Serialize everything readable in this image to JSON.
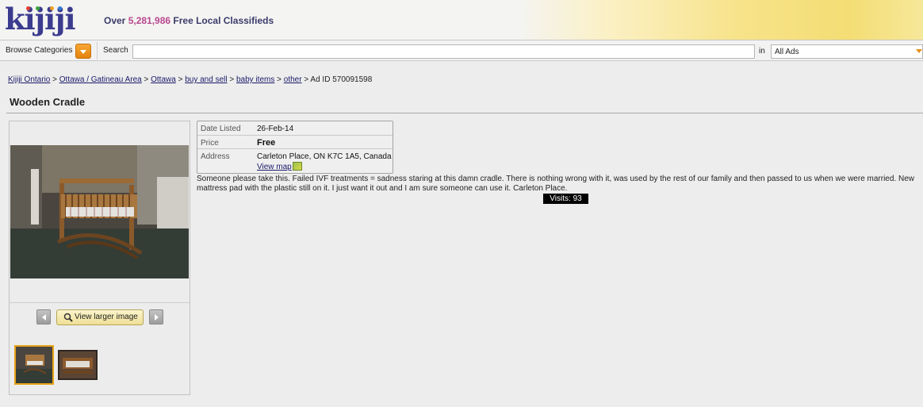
{
  "header": {
    "logo": "kijiji",
    "tagline_prefix": "Over ",
    "tagline_count": "5,281,986",
    "tagline_suffix": " Free Local Classifieds"
  },
  "searchbar": {
    "browse_label": "Browse Categories",
    "search_label": "Search",
    "search_value": "",
    "in_label": "in",
    "category_selected": "All Ads"
  },
  "breadcrumb": {
    "items": [
      "Kijiji Ontario",
      "Ottawa / Gatineau Area",
      "Ottawa",
      "buy and sell",
      "baby items",
      "other"
    ],
    "separator": ">",
    "ad_id": "Ad ID 570091598"
  },
  "page_title": "Wooden Cradle",
  "gallery": {
    "view_larger_label": "View larger image"
  },
  "details": {
    "date_label": "Date Listed",
    "date_value": "26-Feb-14",
    "price_label": "Price",
    "price_value": "Free",
    "address_label": "Address",
    "address_value": "Carleton Place, ON K7C 1A5, Canada",
    "map_link": "View map"
  },
  "description": "Someone please take this. Failed IVF treatments = sadness staring at this damn cradle.  There is nothing wrong with it, was used by the rest of our family and then passed to us when we were married.  New mattress pad with the plastic still on it.   I just want it out and I am sure someone can use it.  Carleton Place.",
  "visits": "Visits: 93",
  "colors": {
    "accent_orange": "#e8901a",
    "logo_blue": "#3b3b8f",
    "count_pink": "#b8478f"
  }
}
